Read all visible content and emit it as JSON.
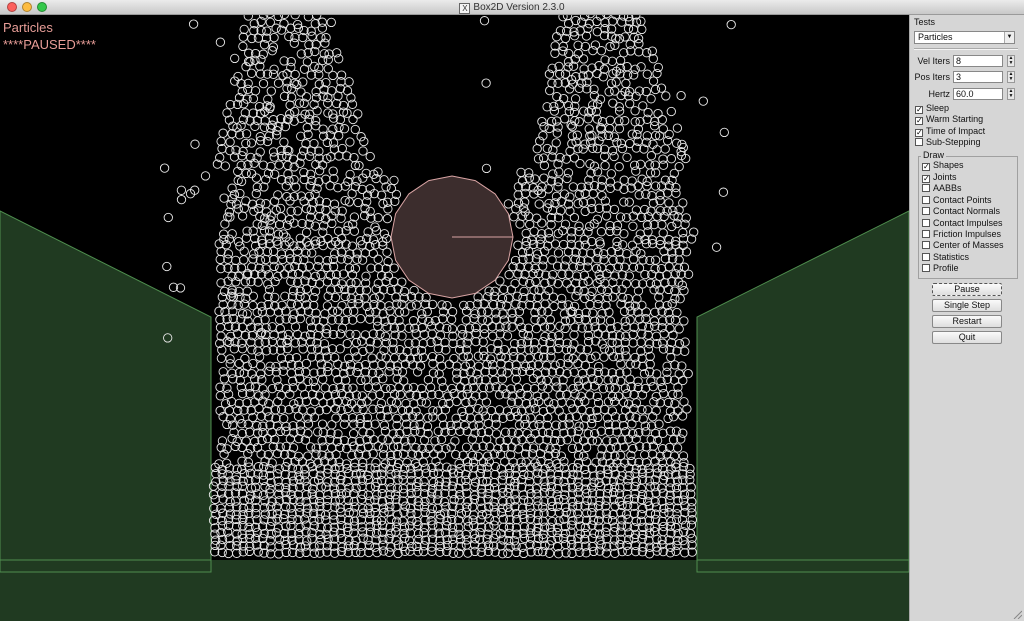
{
  "window": {
    "title": "Box2D Version 2.3.0"
  },
  "simulation": {
    "test_name": "Particles",
    "status": "****PAUSED****",
    "colors": {
      "ground_fill": "#203a21",
      "ground_edge": "#4f8f4f",
      "circle_fill": "#3c2d2d",
      "circle_edge": "#d9a4a4",
      "particle": "#e8e8e8",
      "text": "#e79d97"
    }
  },
  "panel": {
    "tests_label": "Tests",
    "tests_selected": "Particles",
    "vel_iters_label": "Vel Iters",
    "vel_iters_value": "8",
    "pos_iters_label": "Pos Iters",
    "pos_iters_value": "3",
    "hertz_label": "Hertz",
    "hertz_value": "60.0",
    "options": [
      {
        "label": "Sleep",
        "checked": true
      },
      {
        "label": "Warm Starting",
        "checked": true
      },
      {
        "label": "Time of Impact",
        "checked": true
      },
      {
        "label": "Sub-Stepping",
        "checked": false
      }
    ],
    "draw_label": "Draw",
    "draw_options": [
      {
        "label": "Shapes",
        "checked": true
      },
      {
        "label": "Joints",
        "checked": true
      },
      {
        "label": "AABBs",
        "checked": false
      },
      {
        "label": "Contact Points",
        "checked": false
      },
      {
        "label": "Contact Normals",
        "checked": false
      },
      {
        "label": "Contact Impulses",
        "checked": false
      },
      {
        "label": "Friction Impulses",
        "checked": false
      },
      {
        "label": "Center of Masses",
        "checked": false
      },
      {
        "label": "Statistics",
        "checked": false
      },
      {
        "label": "Profile",
        "checked": false
      }
    ],
    "buttons": {
      "pause": "Pause",
      "single_step": "Single Step",
      "restart": "Restart",
      "quit": "Quit"
    }
  }
}
